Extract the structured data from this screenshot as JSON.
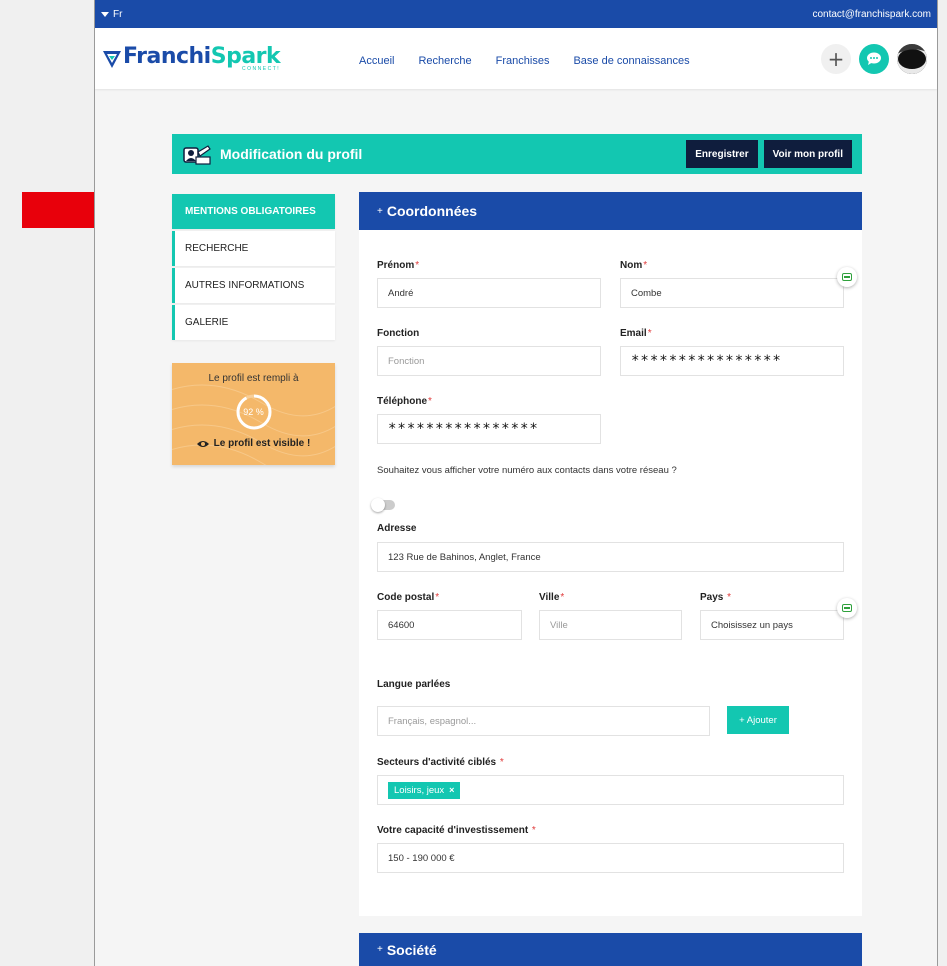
{
  "topbar": {
    "language": "Fr",
    "contact_email": "contact@franchispark.com"
  },
  "header": {
    "logo_part1": "Franchi",
    "logo_part2": "Spark",
    "logo_tagline": "CONNECT!",
    "nav": [
      "Accueil",
      "Recherche",
      "Franchises",
      "Base de connaissances"
    ]
  },
  "banner": {
    "title": "Modification du profil",
    "save_label": "Enregistrer",
    "view_label": "Voir mon profil"
  },
  "sidemenu": {
    "items": [
      "MENTIONS OBLIGATOIRES",
      "RECHERCHE",
      "AUTRES INFORMATIONS",
      "GALERIE"
    ],
    "active_index": 0
  },
  "progress": {
    "title": "Le profil est rempli à",
    "percent_label": "92 %",
    "percent": 92,
    "visible_text": "Le profil est visible !"
  },
  "section": {
    "title": "Coordonnées",
    "toggle": "+"
  },
  "form": {
    "prenom": {
      "label": "Prénom",
      "value": "André"
    },
    "nom": {
      "label": "Nom",
      "value": "Combe"
    },
    "fonction": {
      "label": "Fonction",
      "placeholder": "Fonction"
    },
    "email": {
      "label": "Email",
      "value": "****************"
    },
    "telephone": {
      "label": "Téléphone",
      "value": "****************"
    },
    "show_phone_question": "Souhaitez vous afficher votre numéro aux contacts dans votre réseau ?",
    "adresse": {
      "label": "Adresse",
      "value": "123 Rue de Bahinos, Anglet, France"
    },
    "code_postal": {
      "label": "Code postal",
      "value": "64600"
    },
    "ville": {
      "label": "Ville",
      "placeholder": "Ville"
    },
    "pays": {
      "label": "Pays",
      "value": "Choisissez un pays"
    },
    "langues": {
      "label": "Langue parlées",
      "placeholder": "Français, espagnol...",
      "add_label": "+ Ajouter"
    },
    "secteurs": {
      "label": "Secteurs d'activité ciblés",
      "tags": [
        "Loisirs, jeux"
      ]
    },
    "investissement": {
      "label": "Votre capacité d'investissement",
      "value": "150 - 190 000 €"
    }
  },
  "societe": {
    "title": "Société",
    "toggle": "+"
  },
  "colors": {
    "primary": "#1a4ba8",
    "accent": "#13c7b1",
    "dark": "#0f1d3d",
    "progress_bg": "#f4b86a",
    "arrow": "#e8000b"
  }
}
